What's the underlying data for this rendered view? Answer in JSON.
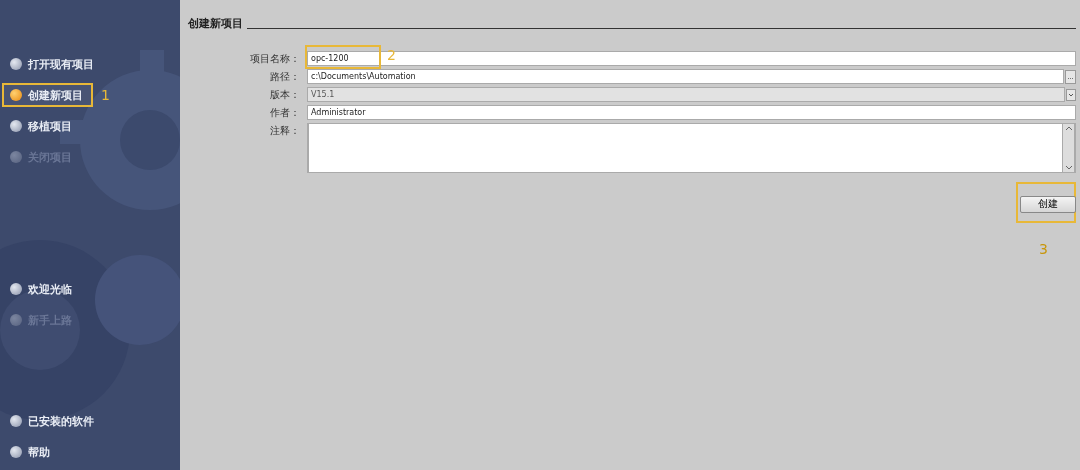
{
  "sidebar": {
    "groups": [
      {
        "items": [
          {
            "label": "打开现有项目",
            "selected": false,
            "disabled": false
          },
          {
            "label": "创建新项目",
            "selected": true,
            "disabled": false,
            "callout": "1"
          },
          {
            "label": "移植项目",
            "selected": false,
            "disabled": false
          },
          {
            "label": "关闭项目",
            "selected": false,
            "disabled": true
          }
        ]
      },
      {
        "items": [
          {
            "label": "欢迎光临",
            "selected": false,
            "disabled": false
          },
          {
            "label": "新手上路",
            "selected": false,
            "disabled": true
          }
        ]
      },
      {
        "items": [
          {
            "label": "已安装的软件",
            "selected": false,
            "disabled": false
          },
          {
            "label": "帮助",
            "selected": false,
            "disabled": false
          }
        ]
      }
    ]
  },
  "panel": {
    "title": "创建新项目",
    "fields": [
      {
        "label": "项目名称：",
        "kind": "text",
        "value": "opc-1200",
        "disabled": false,
        "callout": "2"
      },
      {
        "label": "路径：",
        "kind": "browse",
        "value": "c:\\Documents\\Automation",
        "disabled": false,
        "button": "..."
      },
      {
        "label": "版本：",
        "kind": "dropdown",
        "value": "V15.1",
        "disabled": true
      },
      {
        "label": "作者：",
        "kind": "text",
        "value": "Administrator",
        "disabled": false
      },
      {
        "label": "注释：",
        "kind": "textarea",
        "disabled": false
      }
    ],
    "button": {
      "label": "创建",
      "callout": "3"
    }
  }
}
